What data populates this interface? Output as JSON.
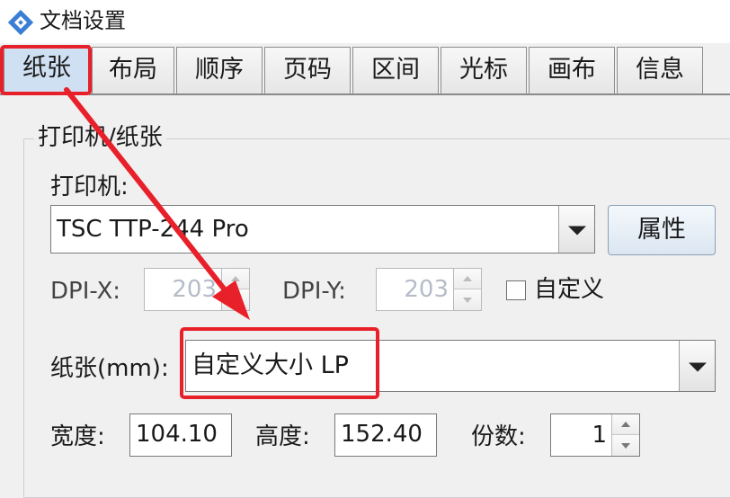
{
  "window": {
    "title": "文档设置"
  },
  "tabs": [
    "纸张",
    "布局",
    "顺序",
    "页码",
    "区间",
    "光标",
    "画布",
    "信息"
  ],
  "group": {
    "title": "打印机/纸张"
  },
  "printer": {
    "label": "打印机:",
    "value": "TSC TTP-244 Pro",
    "properties_button": "属性"
  },
  "dpi": {
    "x_label": "DPI-X:",
    "x_value": "203",
    "y_label": "DPI-Y:",
    "y_value": "203",
    "custom_label": "自定义",
    "custom_checked": false
  },
  "paper": {
    "label": "纸张(mm):",
    "value": "自定义大小 LP"
  },
  "size": {
    "width_label": "宽度:",
    "width_value": "104.10",
    "height_label": "高度:",
    "height_value": "152.40",
    "copies_label": "份数:",
    "copies_value": "1"
  },
  "colors": {
    "highlight": "#e8202a",
    "active_tab": "#cfe0f3",
    "app_icon": "#3a7fd5"
  }
}
